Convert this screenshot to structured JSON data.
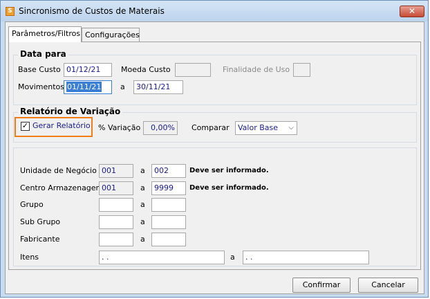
{
  "window": {
    "title": "Sincronismo de Custos de Materais",
    "close_glyph": "✕"
  },
  "tabs": [
    {
      "label": "Parâmetros/Filtros",
      "active": true
    },
    {
      "label": "Configurações",
      "active": false
    }
  ],
  "data_para": {
    "title": "Data para",
    "base_custo_label": "Base Custo",
    "base_custo_value": "01/12/21",
    "moeda_custo_label": "Moeda Custo",
    "moeda_custo_value": "",
    "finalidade_label": "Finalidade de Uso",
    "finalidade_value": "",
    "movimentos_label": "Movimentos",
    "movimentos_from": "01/11/21",
    "a_label": "a",
    "movimentos_to": "30/11/21"
  },
  "relatorio": {
    "title": "Relatório de Variação",
    "gerar_label": "Gerar Relatório",
    "gerar_checked": true,
    "check_glyph": "✓",
    "variacao_label": "% Variação",
    "variacao_value": "0,00%",
    "comparar_label": "Comparar",
    "comparar_value": "Valor Base",
    "arrow_glyph": "⌵"
  },
  "filtros": {
    "a_label": "a",
    "required_hint": "Deve ser informado.",
    "unidade_label": "Unidade de Negócio",
    "unidade_from": "001",
    "unidade_to": "002",
    "centro_label": "Centro Armazenagem",
    "centro_from": "001",
    "centro_to": "9999",
    "grupo_label": "Grupo",
    "subgrupo_label": "Sub Grupo",
    "fabricante_label": "Fabricante",
    "itens_label": "Itens",
    "itens_from": ". .",
    "itens_to": ". ."
  },
  "buttons": {
    "confirmar": "Confirmar",
    "cancelar": "Cancelar"
  },
  "colors": {
    "highlight_border": "#f07d16",
    "field_text": "#1a1a8a",
    "selection": "#3a7fd5"
  }
}
